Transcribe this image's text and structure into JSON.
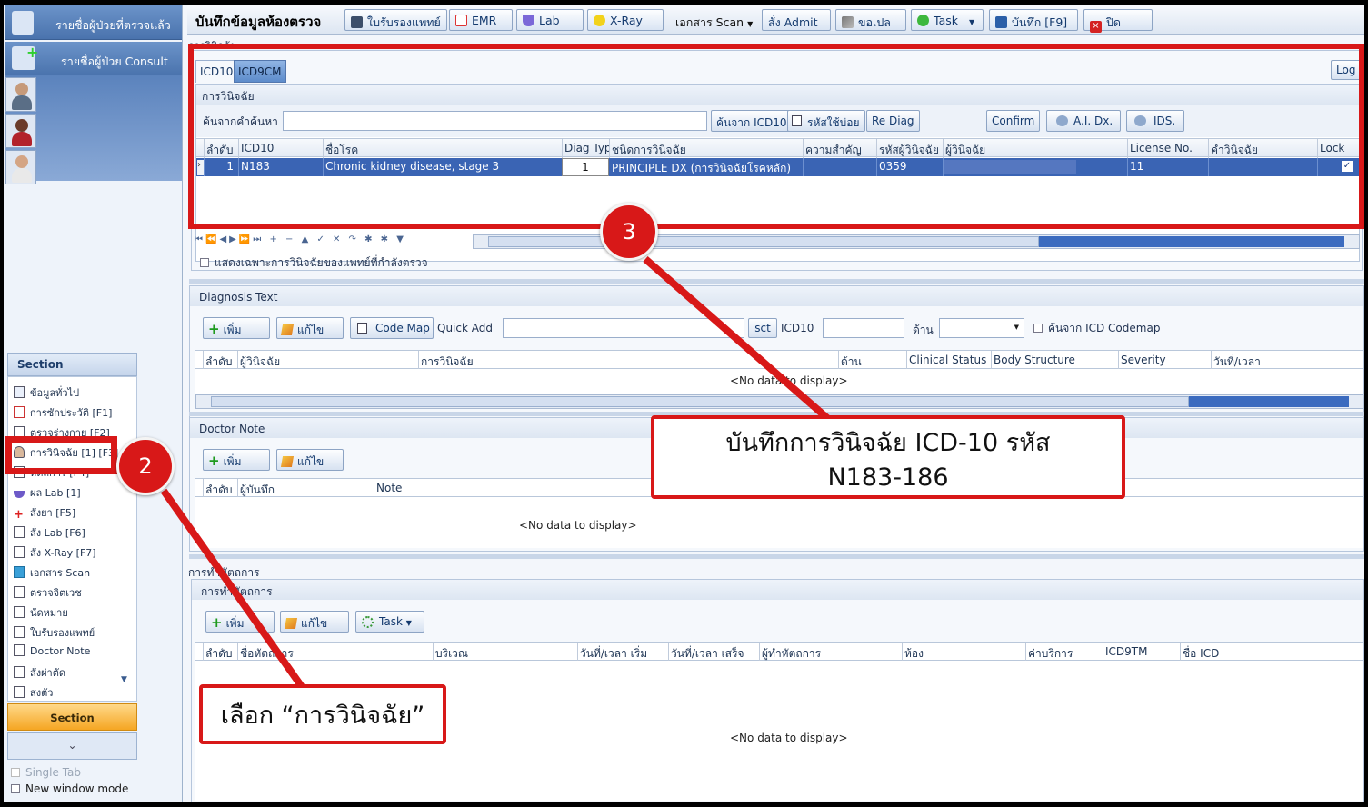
{
  "sidebar": {
    "checked_patients": "รายชื่อผู้ป่วยที่ตรวจแล้ว",
    "consult_patients": "รายชื่อผู้ป่วย Consult",
    "section_header": "Section",
    "section_items": [
      {
        "label": "ข้อมูลทั่วไป",
        "icon": "calendar-icon"
      },
      {
        "label": "การซักประวัติ [F1]",
        "icon": "medical-history-icon"
      },
      {
        "label": "ตรวจร่างกาย [F2]",
        "icon": "exam-icon"
      },
      {
        "label": "การวินิจฉัย [1] [F3]",
        "icon": "doctor-icon"
      },
      {
        "label": "หัตถการ [F4]",
        "icon": "procedure-icon"
      },
      {
        "label": "ผล Lab [1]",
        "icon": "flask-icon"
      },
      {
        "label": "สั่งยา [F5]",
        "icon": "medicine-icon"
      },
      {
        "label": "สั่ง Lab  [F6]",
        "icon": "document-icon"
      },
      {
        "label": "สั่ง X-Ray  [F7]",
        "icon": "document-icon"
      },
      {
        "label": "เอกสาร Scan",
        "icon": "scan-icon"
      },
      {
        "label": "ตรวจจิตเวช",
        "icon": "document-icon"
      },
      {
        "label": "นัดหมาย",
        "icon": "document-icon"
      },
      {
        "label": "ใบรับรองแพทย์",
        "icon": "document-icon"
      },
      {
        "label": "Doctor Note",
        "icon": "document-icon"
      },
      {
        "label": "สั่งผ่าตัด",
        "icon": "document-icon"
      },
      {
        "label": "ส่งตัว",
        "icon": "document-icon"
      }
    ],
    "section_bar": "Section",
    "single_tab": "Single Tab",
    "new_window_mode": "New window mode"
  },
  "toolbar": {
    "title": "บันทึกข้อมูลห้องตรวจ",
    "buttons": {
      "cert": "ใบรับรองแพทย์",
      "emr": "EMR",
      "lab": "Lab",
      "xray": "X-Ray",
      "scan": "เอกสาร Scan",
      "admit": "สั่ง Admit",
      "refer": "ขอเปล",
      "task": "Task",
      "save": "บันทึก [F9]",
      "close": "ปิด"
    }
  },
  "diagnosis": {
    "section_label": "การวินิจฉัย",
    "tabs": [
      "ICD10",
      "ICD9CM"
    ],
    "log_button": "Log",
    "group_label": "การวินิจฉัย",
    "search_label": "ค้นจากคำค้นหา",
    "search_value": "",
    "btn_search_icd10": "ค้นจาก ICD10",
    "btn_frequent": "รหัสใช้บ่อย",
    "btn_rediag": "Re Diag",
    "btn_confirm": "Confirm",
    "btn_ai": "A.I. Dx.",
    "btn_ids": "IDS.",
    "columns": [
      "ลำดับ",
      "ICD10",
      "ชื่อโรค",
      "Diag Type",
      "ชนิดการวินิจฉัย",
      "ความสำคัญ",
      "รหัสผู้วินิจฉัย",
      "ผู้วินิจฉัย",
      "License No.",
      "คำวินิจฉัย",
      "Lock"
    ],
    "rows": [
      {
        "no": "1",
        "icd10": "N183",
        "name": "Chronic kidney disease, stage 3",
        "diag_type": "1",
        "kind": "PRINCIPLE DX (การวินิจฉัยโรคหลัก)",
        "importance": "",
        "doctor_code": "0359",
        "doctor": "",
        "license": "11",
        "diag_text": "",
        "lock": true
      }
    ],
    "only_mine_label": "แสดงเฉพาะการวินิจฉัยของแพทย์ที่กำลังตรวจ"
  },
  "diag_text": {
    "title": "Diagnosis Text",
    "btn_add": "เพิ่ม",
    "btn_edit": "แก้ไข",
    "btn_codemap": "Code Map",
    "quick_add_label": "Quick Add",
    "btn_sct": "sct",
    "icd10_label": "ICD10",
    "side_label": "ด้าน",
    "codemap_check": "ค้นจาก ICD Codemap",
    "columns": [
      "ลำดับ",
      "ผู้วินิจฉัย",
      "การวินิจฉัย",
      "ด้าน",
      "Clinical Status",
      "Body Structure",
      "Severity",
      "วันที่/เวลา"
    ],
    "no_data": "<No data to display>"
  },
  "doctor_note": {
    "title": "Doctor Note",
    "btn_add": "เพิ่ม",
    "btn_edit": "แก้ไข",
    "columns": [
      "ลำดับ",
      "ผู้บันทึก",
      "Note"
    ],
    "no_data": "<No data to display>"
  },
  "procedure": {
    "section_label": "การทำหัตถการ",
    "group_label": "การทำหัตถการ",
    "btn_add": "เพิ่ม",
    "btn_edit": "แก้ไข",
    "btn_task": "Task",
    "columns": [
      "ลำดับ",
      "ชื่อหัตถการ",
      "บริเวณ",
      "วันที่/เวลา เริ่ม",
      "วันที่/เวลา เสร็จ",
      "ผู้ทำหัตถการ",
      "ห้อง",
      "ค่าบริการ",
      "ICD9TM",
      "ชื่อ ICD"
    ],
    "no_data": "<No data to display>"
  },
  "annotations": {
    "step2_number": "2",
    "step2_text": "เลือก “การวินิจฉัย”",
    "step3_number": "3",
    "step3_line1": "บันทึกการวินิจฉัย ICD-10 รหัส",
    "step3_line2": "N183-186",
    "color": "#d81818"
  }
}
